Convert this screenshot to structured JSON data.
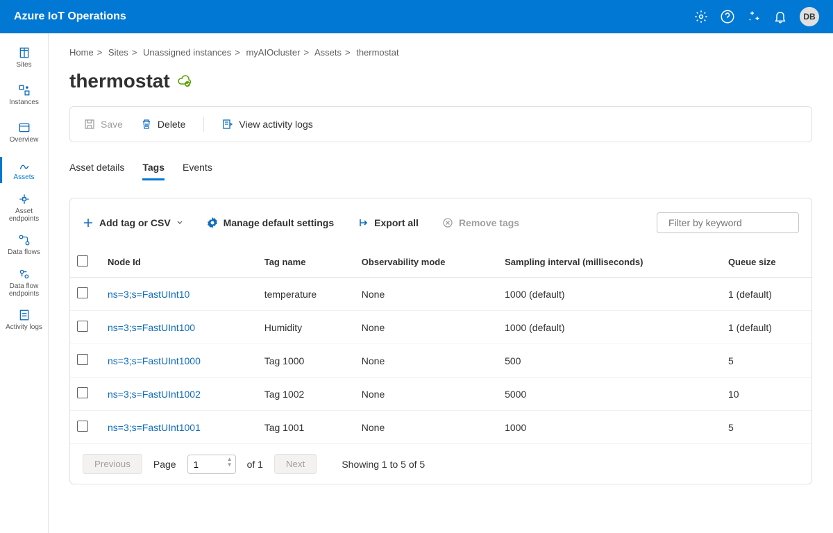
{
  "header": {
    "brand": "Azure IoT Operations",
    "avatar": "DB"
  },
  "sidebar": {
    "items": [
      {
        "label": "Sites"
      },
      {
        "label": "Instances"
      },
      {
        "label": "Overview"
      },
      {
        "label": "Assets"
      },
      {
        "label": "Asset endpoints"
      },
      {
        "label": "Data flows"
      },
      {
        "label": "Data flow endpoints"
      },
      {
        "label": "Activity logs"
      }
    ]
  },
  "breadcrumb": {
    "items": [
      "Home",
      "Sites",
      "Unassigned instances",
      "myAIOcluster",
      "Assets",
      "thermostat"
    ]
  },
  "page": {
    "title": "thermostat"
  },
  "commands": {
    "save": "Save",
    "delete": "Delete",
    "activity": "View activity logs"
  },
  "tabs": {
    "details": "Asset details",
    "tags": "Tags",
    "events": "Events"
  },
  "toolbar": {
    "add": "Add tag or CSV",
    "manage": "Manage default settings",
    "export": "Export all",
    "remove": "Remove tags",
    "filter_placeholder": "Filter by keyword"
  },
  "table": {
    "headers": {
      "node": "Node Id",
      "tag": "Tag name",
      "mode": "Observability mode",
      "interval": "Sampling interval (milliseconds)",
      "queue": "Queue size"
    },
    "rows": [
      {
        "node": "ns=3;s=FastUInt10",
        "tag": "temperature",
        "mode": "None",
        "interval": "1000 (default)",
        "queue": "1 (default)"
      },
      {
        "node": "ns=3;s=FastUInt100",
        "tag": "Humidity",
        "mode": "None",
        "interval": "1000 (default)",
        "queue": "1 (default)"
      },
      {
        "node": "ns=3;s=FastUInt1000",
        "tag": "Tag 1000",
        "mode": "None",
        "interval": "500",
        "queue": "5"
      },
      {
        "node": "ns=3;s=FastUInt1002",
        "tag": "Tag 1002",
        "mode": "None",
        "interval": "5000",
        "queue": "10"
      },
      {
        "node": "ns=3;s=FastUInt1001",
        "tag": "Tag 1001",
        "mode": "None",
        "interval": "1000",
        "queue": "5"
      }
    ]
  },
  "pager": {
    "prev": "Previous",
    "next": "Next",
    "page_label": "Page",
    "page_value": "1",
    "of": "of 1",
    "showing": "Showing 1 to 5 of 5"
  }
}
